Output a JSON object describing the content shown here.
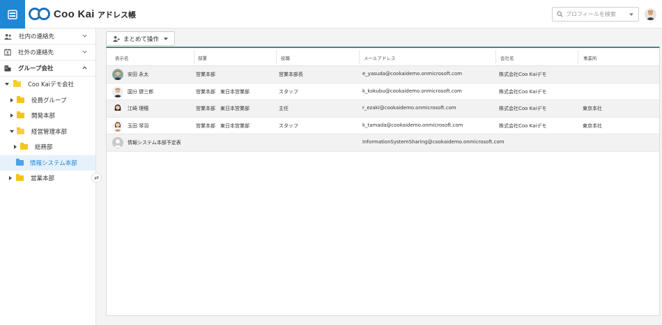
{
  "header": {
    "logo_text": "Coo Kai",
    "page_title": "アドレス帳",
    "search_placeholder": "プロフィールを検索",
    "accent_color": "#1e88d4"
  },
  "sidebar": {
    "sections": [
      {
        "label": "社内の連絡先",
        "icon": "people-icon",
        "chevron": "chevron-down-icon"
      },
      {
        "label": "社外の連絡先",
        "icon": "calendar-contact-icon",
        "chevron": "chevron-down-icon"
      },
      {
        "label": "グループ会社",
        "icon": "building-icon",
        "chevron": "chevron-up-icon"
      }
    ],
    "tree": [
      {
        "label": "Coo Kaiデモ会社",
        "state": "open"
      },
      {
        "label": "役員グループ",
        "state": "collapsed"
      },
      {
        "label": "開発本部",
        "state": "collapsed"
      },
      {
        "label": "経営管理本部",
        "state": "open"
      },
      {
        "label": "総務部",
        "state": "collapsed"
      },
      {
        "label": "情報システム本部",
        "state": "selected"
      },
      {
        "label": "営業本部",
        "state": "collapsed"
      }
    ]
  },
  "toolbar": {
    "bulk_action_label": "まとめて操作"
  },
  "table": {
    "columns": [
      "表示名",
      "部署",
      "役職",
      "メールアドレス",
      "会社名",
      "事業所"
    ],
    "rows": [
      {
        "name": "安田 永太",
        "dept": "営業本部",
        "title": "営業本部長",
        "email": "e_yasuda@cookaidemo.onmicrosoft.com",
        "company": "株式会社Coo Kaiデモ",
        "office": ""
      },
      {
        "name": "国分 健三郎",
        "dept": "営業本部　東日本営業部",
        "title": "スタッフ",
        "email": "k_kokubu@cookaidemo.onmicrosoft.com",
        "company": "株式会社Coo Kaiデモ",
        "office": ""
      },
      {
        "name": "江崎 理穂",
        "dept": "営業本部　東日本営業部",
        "title": "主任",
        "email": "r_ezaki@cookaidemo.onmicrosoft.com",
        "company": "株式会社Coo Kaiデモ",
        "office": "東京本社"
      },
      {
        "name": "玉田 琴羽",
        "dept": "営業本部　東日本営業部",
        "title": "スタッフ",
        "email": "k_tamada@cookaidemo.onmicrosoft.com",
        "company": "株式会社Coo Kaiデモ",
        "office": "東京本社"
      },
      {
        "name": "情報システム本部予定表",
        "dept": "",
        "title": "",
        "email": "InformationSystemSharing@cookaidemo.onmicrosoft.com",
        "company": "",
        "office": ""
      }
    ]
  }
}
